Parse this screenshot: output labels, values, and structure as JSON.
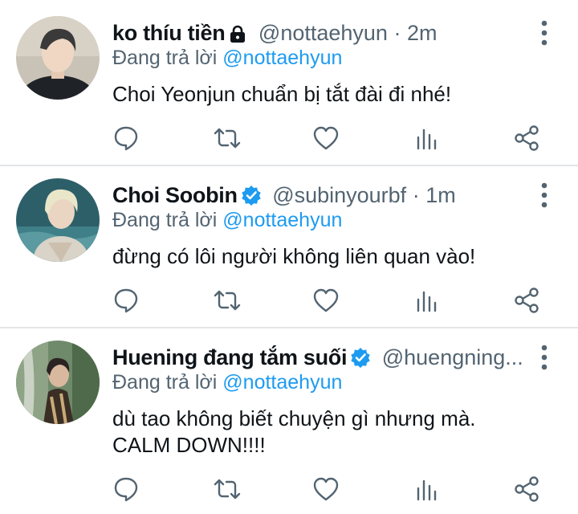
{
  "tweets": [
    {
      "name": "ko thíu tiền",
      "handle": "@nottaehyun",
      "time": "· 2m",
      "badge": "lock-icon",
      "replying_prefix": "Đang trả lời ",
      "replying_to": "@nottaehyun",
      "text": "Choi Yeonjun chuẩn bị tắt đài đi nhé!"
    },
    {
      "name": "Choi Soobin",
      "handle": "@subinyourbf",
      "time": "· 1m",
      "badge": "verified-icon",
      "replying_prefix": "Đang trả lời ",
      "replying_to": "@nottaehyun",
      "text": "đừng có lôi người không liên quan vào!"
    },
    {
      "name": "Huening đang tắm suối",
      "handle": "@huengning...",
      "time": "",
      "badge": "verified-icon",
      "replying_prefix": "Đang trả lời ",
      "replying_to": "@nottaehyun",
      "text": "dù tao không biết chuyện gì nhưng mà.\nCALM DOWN!!!!"
    }
  ],
  "colors": {
    "text": "#0f1419",
    "secondary": "#536471",
    "accent": "#1d9bf0",
    "divider": "#e3e6e8"
  }
}
